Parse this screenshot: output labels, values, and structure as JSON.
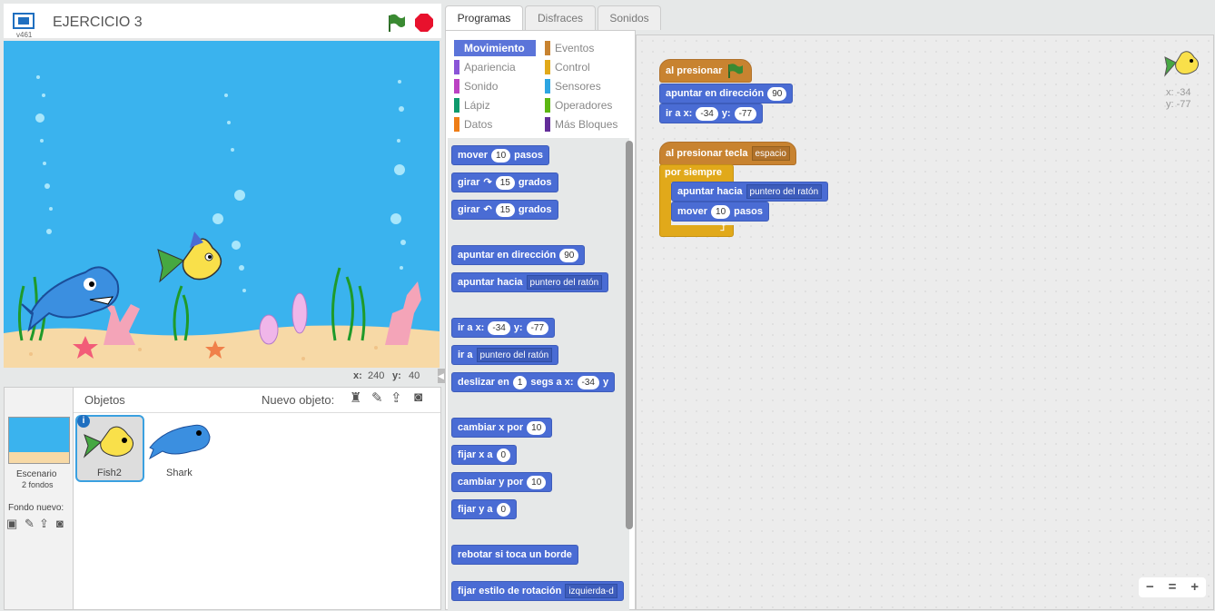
{
  "project": {
    "title": "EJERCICIO 3",
    "version": "v461"
  },
  "stage_coords": {
    "x_label": "x:",
    "x_value": "240",
    "y_label": "y:",
    "y_value": "40"
  },
  "sprites_panel": {
    "heading": "Objetos",
    "new_sprite_label": "Nuevo objeto:",
    "stage_label": "Escenario",
    "stage_backdrops": "2 fondos",
    "new_backdrop_label": "Fondo nuevo:",
    "sprites": [
      {
        "name": "Fish2",
        "selected": true
      },
      {
        "name": "Shark",
        "selected": false
      }
    ],
    "info_icon": "i"
  },
  "tabs": [
    "Programas",
    "Disfraces",
    "Sonidos"
  ],
  "categories": [
    {
      "label": "Movimiento",
      "color": "#4a6cd4",
      "selected": true
    },
    {
      "label": "Eventos",
      "color": "#c88330"
    },
    {
      "label": "Apariencia",
      "color": "#8a55d7"
    },
    {
      "label": "Control",
      "color": "#e1a91a"
    },
    {
      "label": "Sonido",
      "color": "#bb42c3"
    },
    {
      "label": "Sensores",
      "color": "#2ca5e2"
    },
    {
      "label": "Lápiz",
      "color": "#0e9a6c"
    },
    {
      "label": "Operadores",
      "color": "#5cb712"
    },
    {
      "label": "Datos",
      "color": "#ee7d16"
    },
    {
      "label": "Más Bloques",
      "color": "#632d99"
    }
  ],
  "palette_blocks": {
    "move": {
      "a": "mover",
      "n": "10",
      "b": "pasos"
    },
    "turn_right": {
      "a": "girar",
      "icon": "↷",
      "n": "15",
      "b": "grados"
    },
    "turn_left": {
      "a": "girar",
      "icon": "↶",
      "n": "15",
      "b": "grados"
    },
    "point_dir": {
      "a": "apuntar en dirección",
      "n": "90"
    },
    "point_towards": {
      "a": "apuntar hacia",
      "d": "puntero del ratón"
    },
    "goto_xy": {
      "a": "ir a x:",
      "x": "-34",
      "b": "y:",
      "y": "-77"
    },
    "goto": {
      "a": "ir a",
      "d": "puntero del ratón"
    },
    "glide": {
      "a": "deslizar en",
      "n": "1",
      "b": "segs a x:",
      "x": "-34",
      "c": "y"
    },
    "change_x": {
      "a": "cambiar x por",
      "n": "10"
    },
    "set_x": {
      "a": "fijar x a",
      "n": "0"
    },
    "change_y": {
      "a": "cambiar y por",
      "n": "10"
    },
    "set_y": {
      "a": "fijar y a",
      "n": "0"
    },
    "bounce": {
      "a": "rebotar si toca un borde"
    },
    "rotation_style": {
      "a": "fijar estilo de rotación",
      "d": "izquierda-d"
    }
  },
  "script": {
    "hat1": "al presionar",
    "b1": {
      "a": "apuntar en dirección",
      "n": "90"
    },
    "b2": {
      "a": "ir a x:",
      "x": "-34",
      "b": "y:",
      "y": "-77"
    },
    "hat2": {
      "a": "al presionar tecla",
      "d": "espacio"
    },
    "forever": "por siempre",
    "b3": {
      "a": "apuntar hacia",
      "d": "puntero del ratón"
    },
    "b4": {
      "a": "mover",
      "n": "10",
      "b": "pasos"
    },
    "loop_arrow": "⮥"
  },
  "sprite_info": {
    "x": "x: -34",
    "y": "y: -77"
  },
  "zoom": {
    "out": "−",
    "reset": "=",
    "in": "+"
  },
  "colors": {
    "motion": "#4a6cd4",
    "events": "#c88330",
    "control": "#e1a91a",
    "stage_water": "#3ab3ee",
    "sand": "#f7d9a6",
    "stop": "#e8112d",
    "flag": "#3a8a32"
  }
}
